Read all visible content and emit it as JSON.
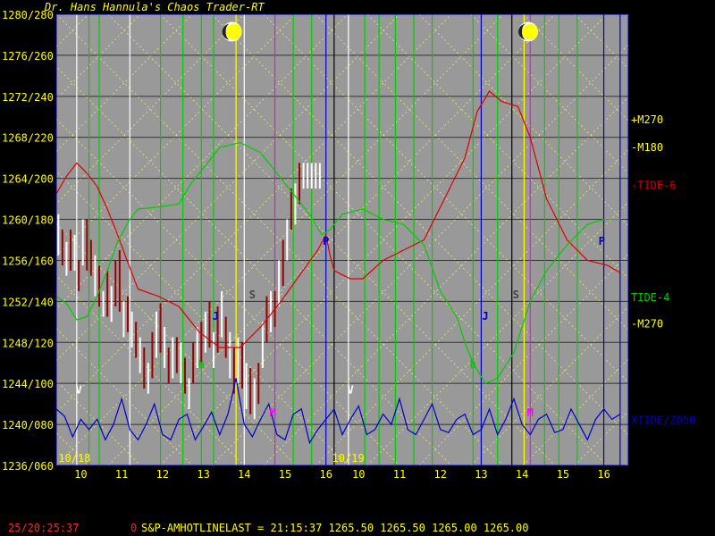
{
  "app_title": "Dr. Hans Hannula's Chaos Trader-RT",
  "status_bar": {
    "time": "25/20:25:37",
    "flag": "0",
    "quote": "S&P-AMHOTLINELAST = 21:15:37 1265.50 1265.50 1265.00 1265.00"
  },
  "colors": {
    "background": "#999999",
    "price_bars": "#ffffff",
    "price_bars_down": "#990000",
    "tide6": "#dd0000",
    "tide4": "#00cc00",
    "xtide": "#0000cc",
    "labels": "#ffff00"
  },
  "chart_data": {
    "type": "line",
    "title": "Dr. Hans Hannula's Chaos Trader-RT",
    "y_ticks": [
      "1280/280",
      "1276/260",
      "1272/240",
      "1268/220",
      "1264/200",
      "1260/180",
      "1256/160",
      "1252/140",
      "1248/120",
      "1244/100",
      "1240/080",
      "1236/060"
    ],
    "y_tick_values": [
      1280,
      1276,
      1272,
      1268,
      1264,
      1260,
      1256,
      1252,
      1248,
      1244,
      1240,
      1236
    ],
    "ylim": [
      1236,
      1280
    ],
    "xlim": [
      0,
      14
    ],
    "x_ticks": [
      {
        "x": 0.6,
        "label": "10"
      },
      {
        "x": 1.6,
        "label": "11"
      },
      {
        "x": 2.6,
        "label": "12"
      },
      {
        "x": 3.6,
        "label": "13"
      },
      {
        "x": 4.6,
        "label": "14"
      },
      {
        "x": 5.6,
        "label": "15"
      },
      {
        "x": 6.6,
        "label": "16"
      },
      {
        "x": 7.4,
        "label": "10"
      },
      {
        "x": 8.4,
        "label": "11"
      },
      {
        "x": 9.4,
        "label": "12"
      },
      {
        "x": 10.4,
        "label": "13"
      },
      {
        "x": 11.4,
        "label": "14"
      },
      {
        "x": 12.4,
        "label": "15"
      },
      {
        "x": 13.4,
        "label": "16"
      }
    ],
    "date_labels": [
      {
        "x": 0.05,
        "label": "10/18"
      },
      {
        "x": 6.75,
        "label": "10/19"
      }
    ],
    "right_labels": [
      {
        "label": "+M270",
        "y": 1269.7,
        "color": "#ffff00"
      },
      {
        "label": "-M180",
        "y": 1267.0,
        "color": "#ffff00"
      },
      {
        "label": "-TIDE-6",
        "y": 1263.3,
        "color": "#dd0000"
      },
      {
        "label": "TIDE-4",
        "y": 1252.4,
        "color": "#00cc00"
      },
      {
        "label": "-M270",
        "y": 1249.8,
        "color": "#ffff00"
      },
      {
        "label": "XTIDE/ZD50",
        "y": 1240.4,
        "color": "#0000cc"
      }
    ],
    "series": [
      {
        "name": "TIDE-6",
        "color": "#dd0000",
        "x": [
          0,
          0.25,
          0.5,
          0.75,
          1,
          1.25,
          1.5,
          1.75,
          2,
          2.5,
          3,
          3.5,
          4,
          4.5,
          5,
          5.5,
          6,
          6.4,
          6.6,
          6.7,
          6.8,
          7.2,
          7.5,
          8,
          8.5,
          9,
          9.5,
          10,
          10.3,
          10.6,
          10.9,
          11.3,
          11.6,
          12,
          12.5,
          13,
          13.5,
          13.8
        ],
        "y": [
          1262.5,
          1264.2,
          1265.5,
          1264.5,
          1263.2,
          1261.0,
          1258.5,
          1255.8,
          1253.2,
          1252.5,
          1251.5,
          1249.0,
          1247.5,
          1247.5,
          1249.5,
          1252.0,
          1254.8,
          1257.0,
          1258.5,
          1256.5,
          1255.0,
          1254.2,
          1254.2,
          1256.0,
          1257.0,
          1258.0,
          1262.0,
          1266.0,
          1270.5,
          1272.5,
          1271.5,
          1271.0,
          1268.0,
          1262.0,
          1258.0,
          1256.0,
          1255.5,
          1254.8
        ]
      },
      {
        "name": "TIDE-4",
        "color": "#00cc00",
        "x": [
          0,
          0.25,
          0.5,
          0.75,
          1,
          1.25,
          1.5,
          1.8,
          2,
          2.5,
          3,
          3.3,
          3.6,
          4,
          4.5,
          5,
          5.5,
          6,
          6.2,
          6.5,
          6.7,
          7,
          7.5,
          8,
          8.5,
          9,
          9.4,
          9.8,
          10,
          10.2,
          10.5,
          10.8,
          11.2,
          11.6,
          12,
          12.5,
          13,
          13.4,
          13.8
        ],
        "y": [
          1252.5,
          1251.8,
          1250.2,
          1250.5,
          1252.5,
          1255.0,
          1257.8,
          1260.0,
          1261.0,
          1261.2,
          1261.5,
          1263.5,
          1265.0,
          1267.0,
          1267.5,
          1266.5,
          1264.0,
          1261.5,
          1260.5,
          1258.5,
          1259.0,
          1260.5,
          1261.0,
          1260.0,
          1259.5,
          1257.5,
          1253.0,
          1250.5,
          1248.0,
          1246.0,
          1244.0,
          1244.5,
          1247.0,
          1252.0,
          1255.0,
          1257.5,
          1259.5,
          1260.0,
          1260.0
        ]
      },
      {
        "name": "XTIDE/ZD50",
        "color": "#0000cc",
        "x": [
          0,
          0.2,
          0.4,
          0.6,
          0.8,
          1,
          1.2,
          1.4,
          1.6,
          1.8,
          2,
          2.2,
          2.4,
          2.6,
          2.8,
          3,
          3.2,
          3.4,
          3.6,
          3.8,
          4,
          4.2,
          4.4,
          4.6,
          4.8,
          5,
          5.2,
          5.4,
          5.6,
          5.8,
          6,
          6.2,
          6.4,
          6.6,
          6.8,
          7,
          7.2,
          7.4,
          7.6,
          7.8,
          8,
          8.2,
          8.4,
          8.6,
          8.8,
          9,
          9.2,
          9.4,
          9.6,
          9.8,
          10,
          10.2,
          10.4,
          10.6,
          10.8,
          11,
          11.2,
          11.4,
          11.6,
          11.8,
          12,
          12.2,
          12.4,
          12.6,
          12.8,
          13,
          13.2,
          13.4,
          13.6,
          13.8
        ],
        "y": [
          1241.5,
          1240.8,
          1238.8,
          1240.5,
          1239.5,
          1240.5,
          1238.5,
          1240.0,
          1242.5,
          1239.5,
          1238.5,
          1240.0,
          1242.0,
          1239.0,
          1238.5,
          1240.5,
          1241.0,
          1238.5,
          1239.8,
          1241.2,
          1239.0,
          1241.0,
          1244.5,
          1240.0,
          1238.8,
          1240.5,
          1242.0,
          1239.0,
          1238.5,
          1241.0,
          1241.5,
          1238.2,
          1239.5,
          1240.5,
          1241.5,
          1239.0,
          1240.5,
          1241.8,
          1239.0,
          1239.5,
          1241.0,
          1240.0,
          1242.5,
          1239.5,
          1239.0,
          1240.5,
          1242.0,
          1239.5,
          1239.2,
          1240.5,
          1241.0,
          1239.0,
          1239.5,
          1241.5,
          1239.0,
          1240.5,
          1242.5,
          1240.0,
          1239.0,
          1240.5,
          1241.0,
          1239.2,
          1239.5,
          1241.5,
          1240.0,
          1238.5,
          1240.5,
          1241.5,
          1240.5,
          1241.0
        ]
      }
    ],
    "price_bars": {
      "color": "#ffffff",
      "x": [
        0.05,
        0.15,
        0.25,
        0.35,
        0.45,
        0.55,
        0.65,
        0.75,
        0.85,
        0.95,
        1.05,
        1.15,
        1.25,
        1.35,
        1.45,
        1.55,
        1.65,
        1.75,
        1.85,
        1.95,
        2.05,
        2.15,
        2.25,
        2.35,
        2.45,
        2.55,
        2.65,
        2.75,
        2.85,
        2.95,
        3.05,
        3.15,
        3.25,
        3.35,
        3.45,
        3.55,
        3.65,
        3.75,
        3.85,
        3.95,
        4.05,
        4.15,
        4.25,
        4.35,
        4.45,
        4.55,
        4.65,
        4.75,
        4.85,
        4.95,
        5.05,
        5.15,
        5.25,
        5.35,
        5.45,
        5.55,
        5.65,
        5.75,
        5.85,
        5.95,
        6.05,
        6.15,
        6.25,
        6.35,
        6.45
      ],
      "high": [
        1260.5,
        1259.0,
        1257.8,
        1259.0,
        1258.5,
        1256.0,
        1260.0,
        1260.0,
        1258.0,
        1256.5,
        1255.5,
        1253.0,
        1255.0,
        1253.5,
        1256.0,
        1257.0,
        1252.0,
        1252.5,
        1251.0,
        1250.0,
        1248.5,
        1247.5,
        1246.0,
        1249.0,
        1251.0,
        1251.8,
        1249.5,
        1247.5,
        1248.5,
        1248.5,
        1248.0,
        1246.5,
        1244.5,
        1248.0,
        1249.5,
        1250.0,
        1251.0,
        1252.0,
        1249.0,
        1251.5,
        1253.0,
        1250.5,
        1249.0,
        1247.5,
        1248.5,
        1248.0,
        1246.0,
        1245.5,
        1244.5,
        1246.0,
        1250.0,
        1252.5,
        1253.0,
        1253.0,
        1256.0,
        1258.0,
        1260.0,
        1263.0,
        1263.5,
        1265.5,
        1265.5,
        1265.5,
        1265.5,
        1265.5,
        1265.5
      ],
      "low": [
        1256.5,
        1255.5,
        1254.5,
        1255.0,
        1255.0,
        1253.0,
        1255.5,
        1255.0,
        1254.5,
        1252.5,
        1251.5,
        1250.5,
        1250.5,
        1250.0,
        1251.5,
        1251.0,
        1248.5,
        1249.0,
        1247.5,
        1246.5,
        1245.0,
        1243.5,
        1243.0,
        1244.5,
        1246.5,
        1247.0,
        1245.5,
        1244.0,
        1244.5,
        1245.0,
        1244.0,
        1243.0,
        1241.5,
        1244.0,
        1245.5,
        1246.0,
        1247.0,
        1247.5,
        1245.5,
        1247.0,
        1248.5,
        1246.5,
        1244.5,
        1243.0,
        1244.0,
        1243.5,
        1241.5,
        1241.0,
        1240.5,
        1242.0,
        1245.5,
        1248.0,
        1249.0,
        1249.5,
        1251.5,
        1253.5,
        1256.0,
        1259.0,
        1259.5,
        1261.5,
        1263.0,
        1263.0,
        1263.0,
        1263.0,
        1263.0
      ],
      "down": [
        false,
        true,
        false,
        true,
        false,
        true,
        false,
        true,
        true,
        false,
        true,
        false,
        true,
        false,
        true,
        true,
        false,
        true,
        false,
        true,
        false,
        true,
        false,
        true,
        false,
        true,
        false,
        true,
        false,
        true,
        false,
        true,
        false,
        true,
        false,
        true,
        false,
        true,
        false,
        true,
        false,
        true,
        false,
        true,
        false,
        true,
        false,
        true,
        false,
        true,
        false,
        true,
        false,
        true,
        false,
        true,
        false,
        true,
        false,
        true,
        false,
        false,
        false,
        false,
        false
      ]
    },
    "vertical_lines": [
      {
        "x": 0.5,
        "color": "#ffffff"
      },
      {
        "x": 1.8,
        "color": "#ffffff"
      },
      {
        "x": 4.6,
        "color": "#ffffff"
      },
      {
        "x": 7.15,
        "color": "#ffffff"
      },
      {
        "x": 5.35,
        "color": "#ff00ff"
      },
      {
        "x": 11.6,
        "color": "#ff00ff"
      },
      {
        "x": 4.4,
        "color": "#ffff00"
      },
      {
        "x": 11.45,
        "color": "#ffff00"
      },
      {
        "x": 6.6,
        "color": "#0000cc"
      },
      {
        "x": 10.4,
        "color": "#0000cc"
      },
      {
        "x": 13.4,
        "color": "#0000cc"
      },
      {
        "x": 13.8,
        "color": "#0000cc"
      },
      {
        "x": 6.8,
        "color": "#000000"
      },
      {
        "x": 11.15,
        "color": "#000000"
      },
      {
        "x": 0.8,
        "color": "#00cc00"
      },
      {
        "x": 1.05,
        "color": "#00cc00"
      },
      {
        "x": 2.55,
        "color": "#00cc00"
      },
      {
        "x": 3.1,
        "color": "#00cc00"
      },
      {
        "x": 3.55,
        "color": "#00cc00"
      },
      {
        "x": 3.85,
        "color": "#00cc00"
      },
      {
        "x": 5.8,
        "color": "#00cc00"
      },
      {
        "x": 6.25,
        "color": "#00cc00"
      },
      {
        "x": 7.55,
        "color": "#00cc00"
      },
      {
        "x": 7.9,
        "color": "#00cc00"
      },
      {
        "x": 8.3,
        "color": "#00cc00"
      },
      {
        "x": 8.75,
        "color": "#00cc00"
      },
      {
        "x": 9.2,
        "color": "#00cc00"
      },
      {
        "x": 10.2,
        "color": "#00cc00"
      },
      {
        "x": 10.8,
        "color": "#00cc00"
      },
      {
        "x": 11.95,
        "color": "#00cc00"
      },
      {
        "x": 12.3,
        "color": "#00cc00"
      },
      {
        "x": 12.75,
        "color": "#00cc00"
      }
    ],
    "markers": [
      {
        "label": "V",
        "x": 0.55,
        "y": 1243.0,
        "color": "#ffffff"
      },
      {
        "label": "V",
        "x": 7.2,
        "y": 1243.0,
        "color": "#ffffff"
      },
      {
        "label": "P",
        "x": 6.6,
        "y": 1257.5,
        "color": "#0000cc"
      },
      {
        "label": "P",
        "x": 13.35,
        "y": 1257.5,
        "color": "#0000cc"
      },
      {
        "label": "S",
        "x": 4.8,
        "y": 1252.3,
        "color": "#444444"
      },
      {
        "label": "S",
        "x": 11.25,
        "y": 1252.3,
        "color": "#444444"
      },
      {
        "label": "J",
        "x": 3.9,
        "y": 1250.2,
        "color": "#0000cc"
      },
      {
        "label": "J",
        "x": 10.5,
        "y": 1250.2,
        "color": "#0000cc"
      },
      {
        "label": "h",
        "x": 3.55,
        "y": 1245.5,
        "color": "#00cc00"
      },
      {
        "label": "h",
        "x": 10.2,
        "y": 1245.5,
        "color": "#00cc00"
      },
      {
        "label": "M",
        "x": 5.3,
        "y": 1240.8,
        "color": "#ff00ff"
      },
      {
        "label": "M",
        "x": 11.6,
        "y": 1240.8,
        "color": "#ff00ff"
      }
    ],
    "moons": [
      {
        "x": 4.3,
        "y": 1278.3
      },
      {
        "x": 11.55,
        "y": 1278.3
      }
    ],
    "grid": true
  }
}
